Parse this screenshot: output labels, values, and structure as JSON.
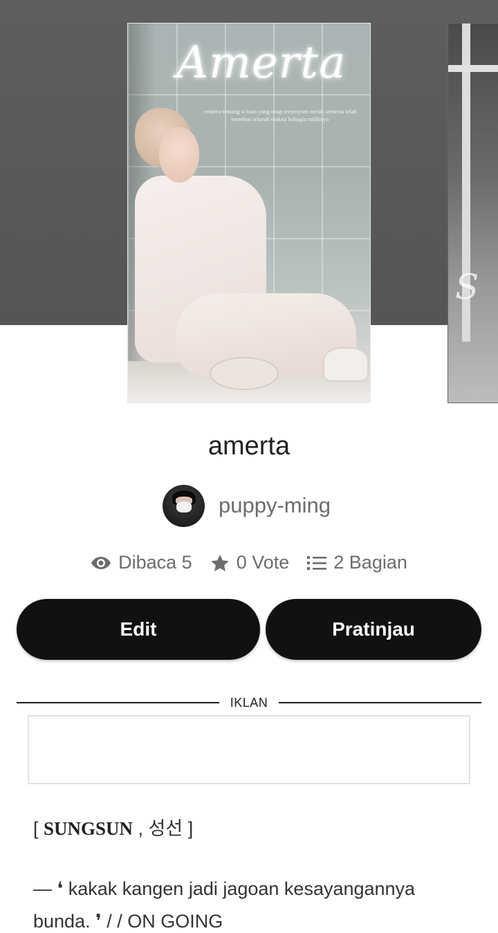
{
  "cover": {
    "title": "Amerta",
    "subtitle": "ceritera tentang si tuan yang tetap tersenyum meski semesta telah merebut seluruh makna bahagia miliknya"
  },
  "story": {
    "title": "amerta",
    "author": "puppy-ming"
  },
  "stats": {
    "reads": "Dibaca 5",
    "votes": "0 Vote",
    "parts": "2 Bagian"
  },
  "actions": {
    "edit_label": "Edit",
    "preview_label": "Pratinjau"
  },
  "ad": {
    "label": "IKLAN"
  },
  "description": {
    "line1_open": "[ ",
    "line1_bold": "SUNGSUN",
    "line1_rest": " , 성선 ]",
    "line2": "— ❛ kakak kangen jadi jagoan kesayangannya bunda. ❜ / / ON GOING"
  },
  "icons": {
    "reads": "eye-icon",
    "votes": "star-icon",
    "parts": "list-icon"
  },
  "colors": {
    "button_bg": "#111111",
    "button_text": "#ffffff",
    "meta_text": "#6c6c6c"
  }
}
